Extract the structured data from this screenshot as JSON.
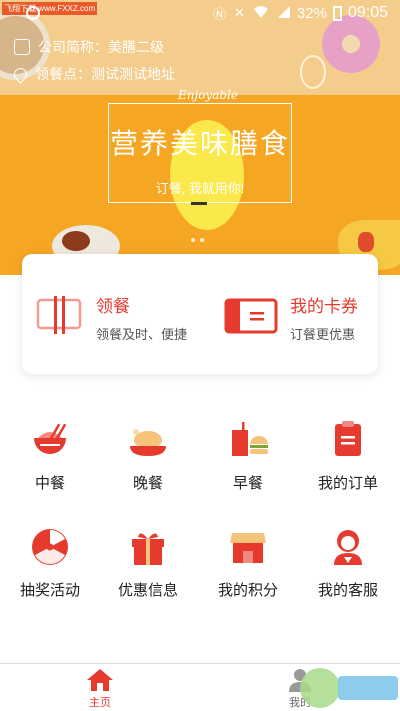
{
  "status_bar": {
    "watermark_label": "飞翔下载 www.FXXZ.com",
    "battery": "32%",
    "time": "09:05"
  },
  "header": {
    "company_label": "公司简称：美膳二级",
    "pickup_label": "领餐点：测试测试地址"
  },
  "banner": {
    "script_text": "Enjoyable",
    "title": "营养美味膳食",
    "subtitle": "订餐, 我就用你!",
    "page_dots": 2
  },
  "card": {
    "left": {
      "title": "领餐",
      "desc": "领餐及时、便捷"
    },
    "right": {
      "title": "我的卡券",
      "desc": "订餐更优惠"
    }
  },
  "grid": [
    {
      "label": "中餐",
      "icon": "bowl-chopsticks-icon"
    },
    {
      "label": "晚餐",
      "icon": "roast-chicken-icon"
    },
    {
      "label": "早餐",
      "icon": "drink-burger-icon"
    },
    {
      "label": "我的订单",
      "icon": "clipboard-icon"
    },
    {
      "label": "抽奖活动",
      "icon": "lottery-wheel-icon"
    },
    {
      "label": "优惠信息",
      "icon": "gift-box-icon"
    },
    {
      "label": "我的积分",
      "icon": "shop-awning-icon"
    },
    {
      "label": "我的客服",
      "icon": "service-agent-icon"
    }
  ],
  "bottom_nav": {
    "home": "主页",
    "mine": "我的"
  },
  "colors": {
    "accent": "#e63a2f",
    "banner": "#f5a623",
    "icon_red": "#e63a2f"
  }
}
